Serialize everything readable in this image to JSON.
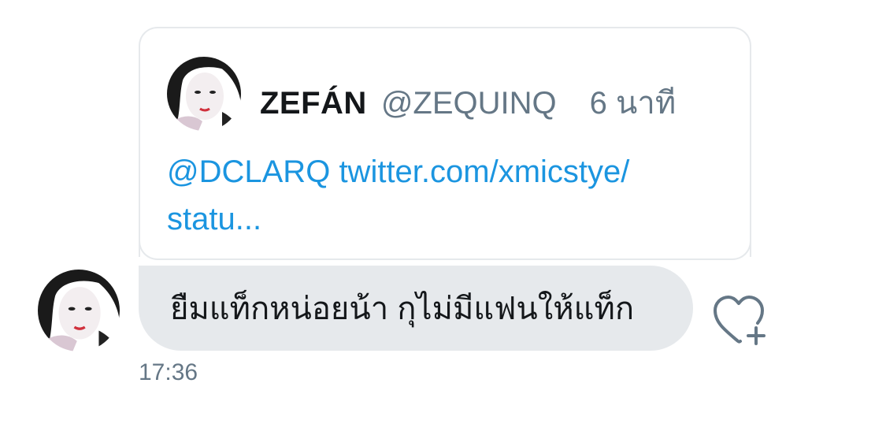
{
  "quoted_tweet": {
    "display_name": "ZEFÁN",
    "handle": "@ZEQUINQ",
    "time": "6 นาที",
    "mention": "@DCLARQ",
    "link_line1": "twitter.com/xmicstye/",
    "link_line2": "statu..."
  },
  "message": {
    "text": "ยืมแท็กหน่อยน้า กุไม่มีแฟนให้แท็ก",
    "timestamp": "17:36"
  },
  "icons": {
    "like": "heart-plus-icon",
    "avatar": "avatar"
  },
  "colors": {
    "link": "#1b95e0",
    "muted": "#657786",
    "bubble": "#e6e9ec",
    "text": "#14171a"
  }
}
